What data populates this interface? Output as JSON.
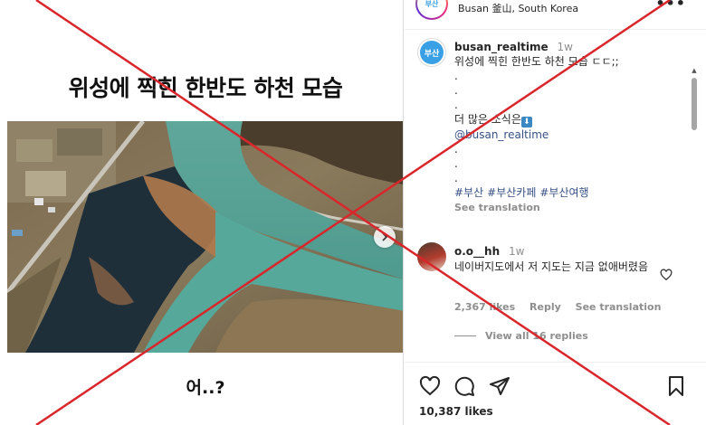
{
  "location": {
    "avatar_text": "부산",
    "text": "Busan 釜山, South Korea"
  },
  "media": {
    "title": "위성에 찍힌 한반도 하천 모습",
    "caption": "어..?"
  },
  "caption": {
    "username": "busan_realtime",
    "time": "1w",
    "avatar_text": "부산",
    "first_line": "위성에 찍힌 한반도 하천 모습 ㄷㄷ;;",
    "dots_a": [
      ".",
      ".",
      "."
    ],
    "more_text": "더 많은 소식은",
    "emoji_label": "⬇",
    "mention": "@busan_realtime",
    "dots_b": [
      ".",
      ".",
      "."
    ],
    "hashtags": [
      "#부산",
      "#부산카페",
      "#부산여행"
    ],
    "see_translation": "See translation"
  },
  "comment": {
    "username": "o.o__hh",
    "time": "1w",
    "text": "네이버지도에서 저 지도는 지금 없애버렸음",
    "likes": "2,367 likes",
    "reply": "Reply",
    "see_translation": "See translation",
    "view_replies": "View all 16 replies"
  },
  "footer": {
    "likes": "10,387 likes"
  },
  "icons": {
    "more": "more-options-icon",
    "like": "heart-icon",
    "comment": "comment-icon",
    "share": "share-icon",
    "save": "bookmark-icon",
    "next": "chevron-right-icon"
  },
  "colors": {
    "overlay_cross": "#d9262b",
    "link": "#385185",
    "muted": "#8e8e8e"
  }
}
